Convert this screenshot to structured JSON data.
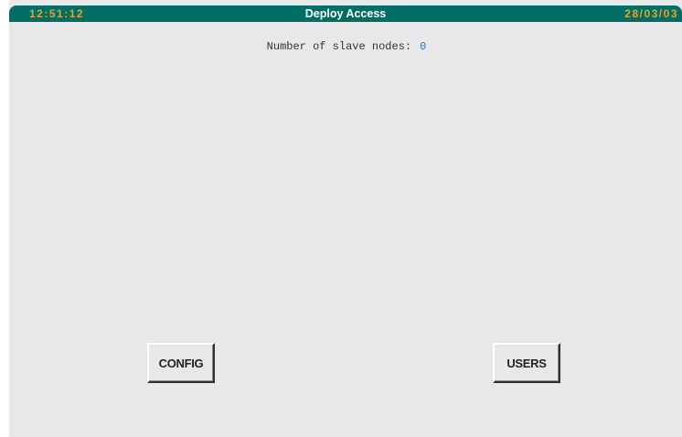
{
  "header": {
    "time": "12:51:12",
    "title": "Deploy Access",
    "date": "28/03/03"
  },
  "status": {
    "slave_nodes_label": "Number of slave nodes:",
    "slave_nodes_count": "0"
  },
  "buttons": {
    "config_label": "CONFIG",
    "users_label": "USERS"
  },
  "colors": {
    "titlebar_bg": "#006e64",
    "clock_text": "#f0a020",
    "title_text": "#ffffff",
    "panel_bg": "#e8e8ea",
    "value_text": "#3a6fc2"
  }
}
